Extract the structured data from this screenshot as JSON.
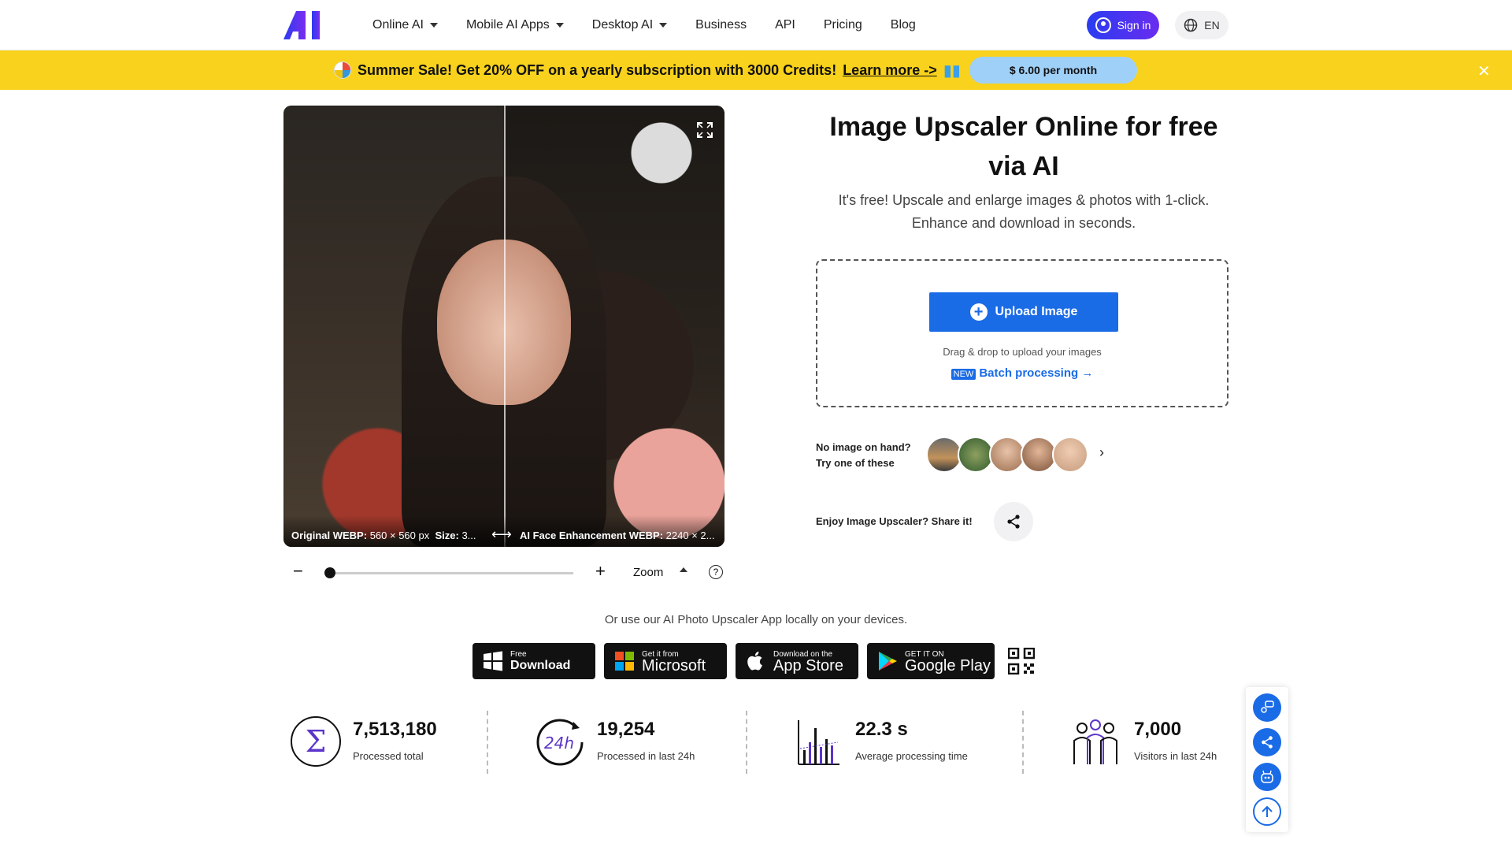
{
  "header": {
    "nav": [
      {
        "label": "Online AI",
        "dropdown": true
      },
      {
        "label": "Mobile AI Apps",
        "dropdown": true
      },
      {
        "label": "Desktop AI",
        "dropdown": true
      },
      {
        "label": "Business",
        "dropdown": false
      },
      {
        "label": "API",
        "dropdown": false
      },
      {
        "label": "Pricing",
        "dropdown": false
      },
      {
        "label": "Blog",
        "dropdown": false
      }
    ],
    "signin_label": "Sign in",
    "lang_label": "EN",
    "brand_colors": [
      "#2a3cf0",
      "#6a2cf0"
    ]
  },
  "banner": {
    "text": "Summer Sale! Get 20% OFF on a yearly subscription with 3000 Credits!",
    "link": "Learn more ->",
    "price": "$ 6.00 per month",
    "close": "✕",
    "color": "#f8d21c"
  },
  "preview": {
    "left_caption_bold": "Original WEBP:",
    "left_caption": "560 × 560 px",
    "left_size_bold": "Size:",
    "left_size": "3...",
    "right_caption_bold": "AI Face Enhancement WEBP:",
    "right_caption": "2240 × 2...",
    "expand_icon": "expand-icon"
  },
  "zoom": {
    "minus": "−",
    "plus": "+",
    "label": "Zoom",
    "help": "?",
    "level": 0.0
  },
  "main": {
    "title": "Image Upscaler Online for free via AI",
    "subtitle": "It's free! Upscale and enlarge images & photos with 1-click. Enhance and download in seconds.",
    "upload_label": "Upload Image",
    "drag_text": "Drag & drop to upload your images",
    "new_badge": "NEW",
    "batch_label": "Batch processing →",
    "accent": "#1a6be6",
    "samples_line1": "No image on hand?",
    "samples_line2": "Try one of these",
    "share_label": "Enjoy Image Upscaler? Share it!"
  },
  "apps": {
    "text": "Or use our AI Photo Upscaler App locally on your devices.",
    "stores": [
      {
        "small": "Free",
        "big": "Download"
      },
      {
        "small": "Get it from",
        "big": "Microsoft"
      },
      {
        "small": "Download on the",
        "big": "App Store"
      },
      {
        "small": "GET IT ON",
        "big": "Google Play"
      }
    ]
  },
  "stats": [
    {
      "num": "7,513,180",
      "label": "Processed total"
    },
    {
      "num": "19,254",
      "label": "Processed in last 24h"
    },
    {
      "num": "22.3 s",
      "label": "Average processing time"
    },
    {
      "num": "7,000",
      "label": "Visitors in last 24h"
    }
  ],
  "stat_24h_label": "24h"
}
